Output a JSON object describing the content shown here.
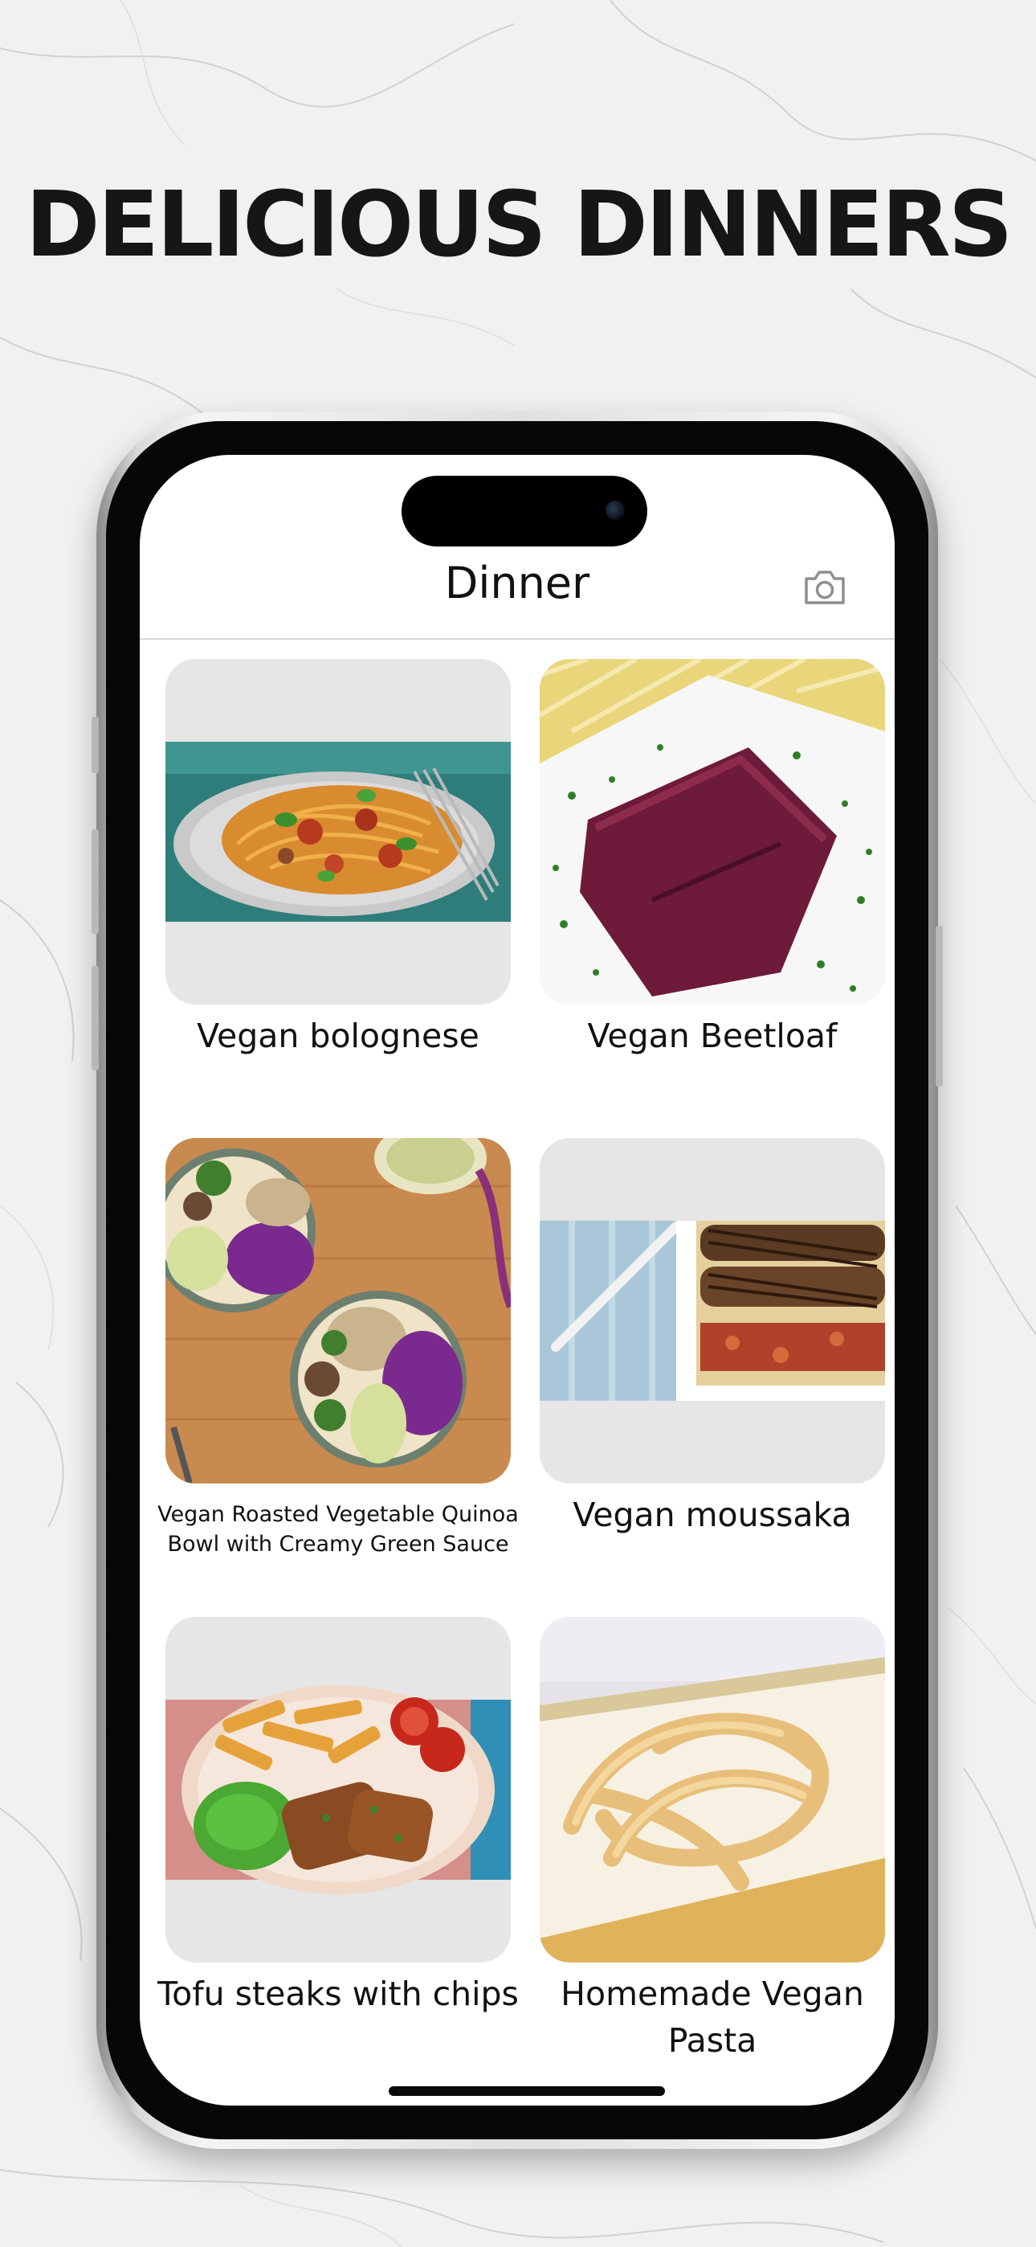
{
  "promo": {
    "headline": "DELICIOUS DINNERS"
  },
  "nav": {
    "title": "Dinner",
    "action_icon": "camera-icon"
  },
  "recipes": [
    {
      "title": "Vegan bolognese"
    },
    {
      "title": "Vegan Beetloaf"
    },
    {
      "title": "Vegan Roasted Vegetable Quinoa Bowl with Creamy Green Sauce"
    },
    {
      "title": "Vegan moussaka"
    },
    {
      "title": "Tofu steaks with chips"
    },
    {
      "title": "Homemade Vegan Pasta"
    }
  ],
  "colors": {
    "background": "#f2f2f2",
    "screen": "#ffffff",
    "text": "#111111",
    "placeholder": "#e6e6e6"
  }
}
